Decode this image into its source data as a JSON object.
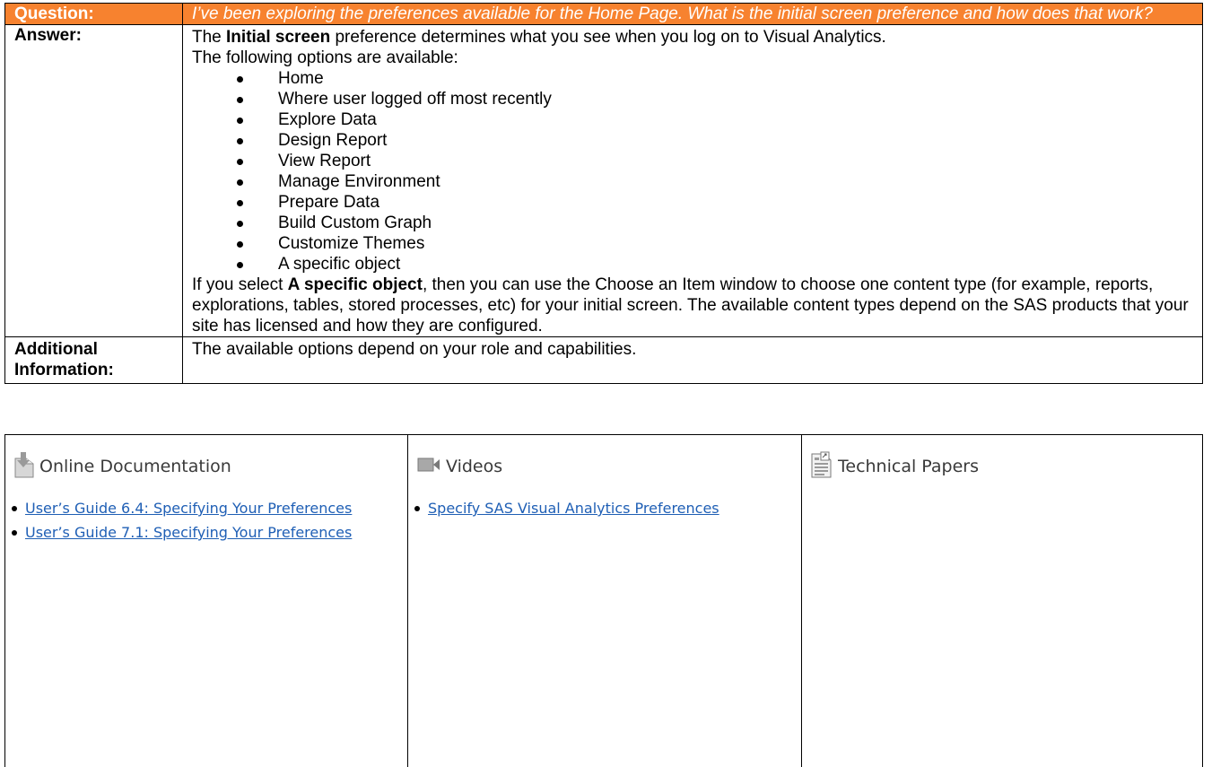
{
  "question": {
    "label": "Question:",
    "text": "I’ve been exploring the preferences available for the Home Page.  What is the initial screen preference and how does that work?"
  },
  "answer": {
    "label": "Answer:",
    "intro_pre": "The ",
    "intro_bold": "Initial screen",
    "intro_post": " preference determines what you see when you log on to Visual Analytics.",
    "line2": "The following options are available:",
    "options": [
      "Home",
      "Where user logged off most recently",
      "Explore Data",
      "Design Report",
      "View Report",
      "Manage Environment",
      "Prepare Data",
      "Build Custom Graph",
      "Customize Themes",
      "A specific object"
    ],
    "select_pre": "If you select ",
    "select_bold": "A specific object",
    "select_post": ", then you can use the Choose an Item window to choose one content type (for example, reports, explorations, tables, stored processes, etc) for your initial screen.  The available content types depend on the SAS products that your site has licensed and how they are configured."
  },
  "additional": {
    "label": "Additional Information:",
    "text": "The available options depend on your role and capabilities."
  },
  "resources": {
    "documentation": {
      "title": "Online Documentation",
      "icon": "download-document-icon",
      "links": [
        "User’s Guide 6.4: Specifying Your Preferences",
        "User’s Guide 7.1: Specifying Your Preferences"
      ]
    },
    "videos": {
      "title": "Videos",
      "icon": "video-camera-icon",
      "links": [
        "Specify SAS Visual Analytics Preferences"
      ]
    },
    "papers": {
      "title": "Technical Papers",
      "icon": "document-icon",
      "links": []
    }
  },
  "colors": {
    "header_bg": "#f7822f",
    "link": "#1f5fb5"
  }
}
